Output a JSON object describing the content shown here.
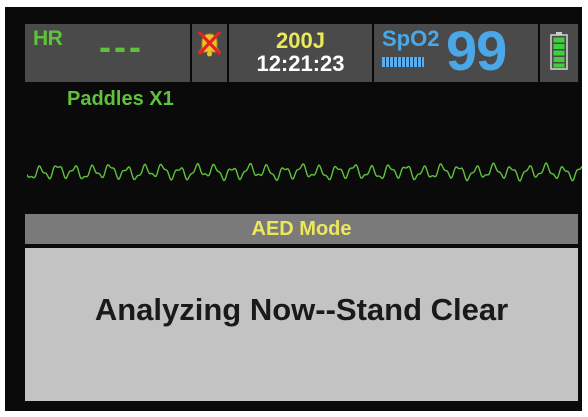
{
  "hr": {
    "label": "HR",
    "value": "---",
    "color": "#5fc23d"
  },
  "alarm": {
    "icon": "alarm-off-icon"
  },
  "energy": {
    "value": "200J",
    "color": "#ece85a"
  },
  "clock": {
    "time": "12:21:23"
  },
  "spo2": {
    "label": "SpO2",
    "value": "99",
    "signal_strength": 1.0,
    "color": "#4aa8e8"
  },
  "battery": {
    "icon": "battery-full-icon",
    "level": 1.0
  },
  "lead": {
    "label": "Paddles X1"
  },
  "ecg": {
    "icon": "ecg-waveform",
    "color": "#5fc23d"
  },
  "mode": {
    "label": "AED Mode"
  },
  "message": {
    "text": "Analyzing Now--Stand Clear"
  }
}
